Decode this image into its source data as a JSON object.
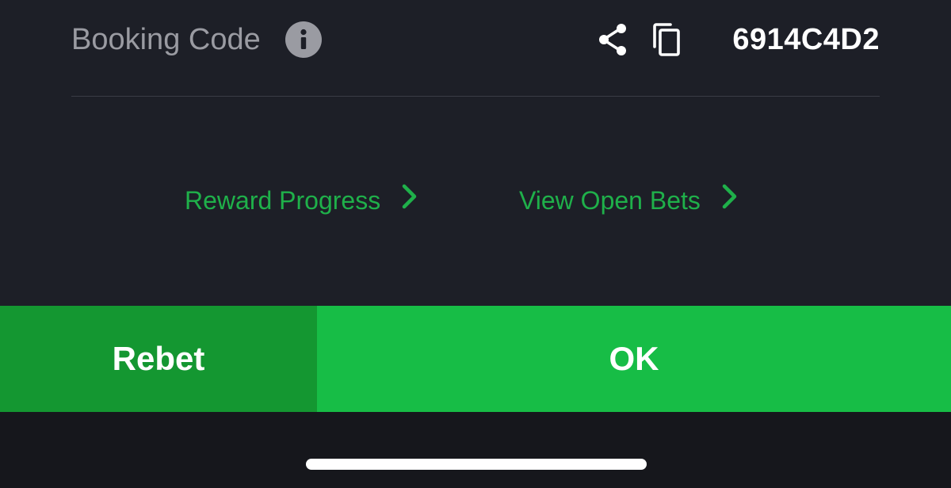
{
  "booking": {
    "label": "Booking Code",
    "code": "6914C4D2",
    "icons": {
      "info": "info-icon",
      "share": "share-icon",
      "copy": "copy-icon"
    }
  },
  "links": {
    "reward_progress": "Reward Progress",
    "view_open_bets": "View Open Bets",
    "chevron_icon": "chevron-right-icon"
  },
  "buttons": {
    "rebet": "Rebet",
    "ok": "OK"
  },
  "colors": {
    "background": "#1d1f27",
    "link_green": "#1fb04a",
    "rebet_green": "#149731",
    "ok_green": "#17bd46",
    "label_gray": "#9a9ba2"
  }
}
